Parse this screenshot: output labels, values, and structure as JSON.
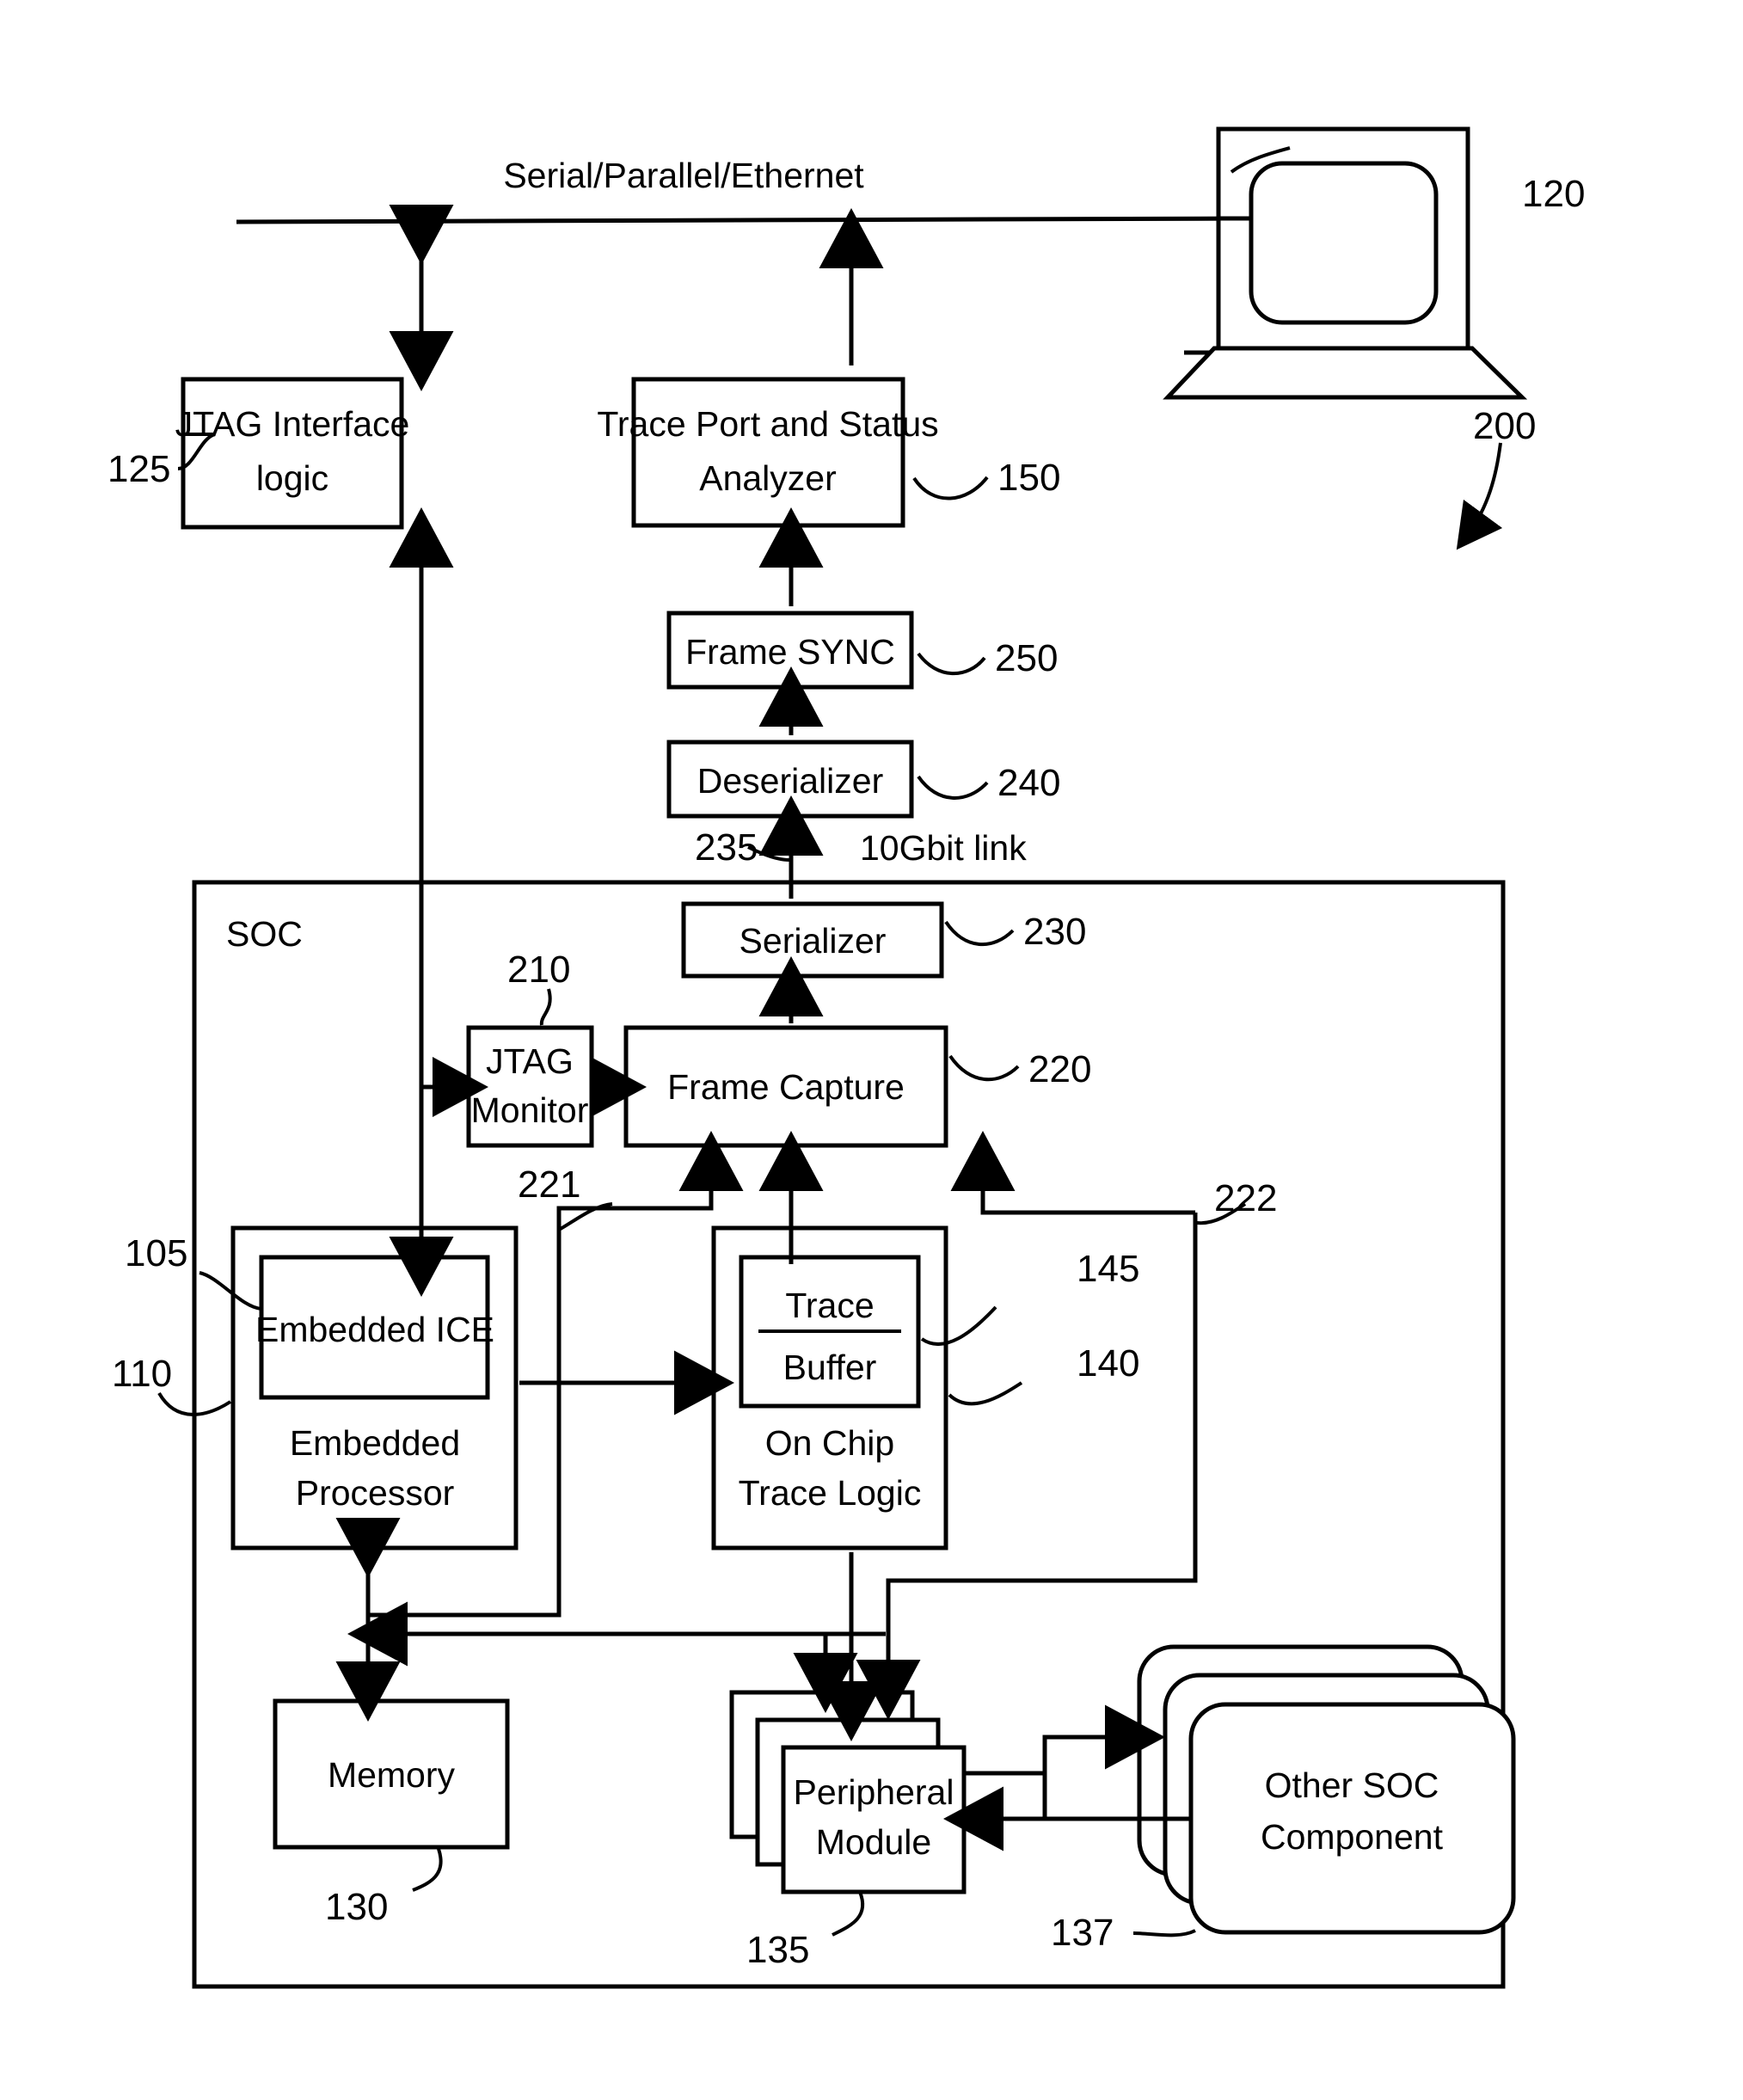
{
  "figure": {
    "title": "SOC trace and debug block diagram",
    "figure_number": "200",
    "bus_label": "Serial/Parallel/Ethernet",
    "link_label": "10Gbit link",
    "soc_label": "SOC"
  },
  "blocks": {
    "jtag_interface_logic": {
      "line1": "JTAG Interface",
      "line2": "logic",
      "ref": "125"
    },
    "trace_port_analyzer": {
      "line1": "Trace Port and Status",
      "line2": "Analyzer",
      "ref": "150"
    },
    "frame_sync": {
      "label": "Frame SYNC",
      "ref": "250"
    },
    "deserializer": {
      "label": "Deserializer",
      "ref": "240"
    },
    "serializer": {
      "label": "Serializer",
      "ref": "230"
    },
    "frame_capture": {
      "label": "Frame Capture",
      "ref": "220"
    },
    "jtag_monitor": {
      "line1": "JTAG",
      "line2": "Monitor",
      "ref": "210"
    },
    "embedded_ice": {
      "label": "Embedded ICE",
      "ref": "105"
    },
    "embedded_processor": {
      "line1": "Embedded",
      "line2": "Processor",
      "ref": "110"
    },
    "trace_buffer": {
      "line1": "Trace",
      "line2": "Buffer",
      "ref": "145"
    },
    "on_chip_trace_logic": {
      "line1": "On Chip",
      "line2": "Trace Logic",
      "ref": "140"
    },
    "memory": {
      "label": "Memory",
      "ref": "130"
    },
    "peripheral_module": {
      "line1": "Peripheral",
      "line2": "Module",
      "ref": "135"
    },
    "other_soc_component": {
      "line1": "Other SOC",
      "line2": "Component",
      "ref": "137"
    },
    "laptop": {
      "ref": "120"
    }
  },
  "connection_refs": {
    "serial_link": "235",
    "trace_bus_left": "221",
    "trace_bus_right": "222"
  },
  "colors": {
    "stroke": "#000000",
    "background": "#ffffff"
  }
}
